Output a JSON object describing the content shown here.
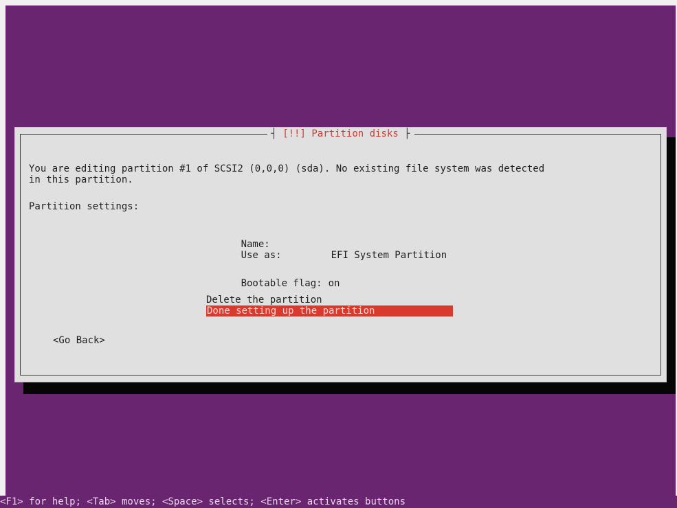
{
  "dialog": {
    "title_prefix": "[!!]",
    "title": "Partition disks",
    "message_line1": "You are editing partition #1 of SCSI2 (0,0,0) (sda). No existing file system was detected",
    "message_line2": "in this partition.",
    "settings_heading": "Partition settings:"
  },
  "settings": {
    "name_label": "Name:",
    "name_value": "",
    "use_as_label": "Use as:",
    "use_as_value": "EFI System Partition",
    "bootable_label": "Bootable flag:",
    "bootable_value": "on"
  },
  "actions": {
    "delete_label": "Delete the partition",
    "done_label": "Done setting up the partition",
    "selected": "done"
  },
  "buttons": {
    "go_back_label": "<Go Back>"
  },
  "status_bar": {
    "text": "<F1> for help; <Tab> moves; <Space> selects; <Enter> activates buttons"
  },
  "colors": {
    "background": "#6a2570",
    "dialog": "#e0e0e0",
    "highlight": "#d83a2e",
    "title": "#d03c32"
  }
}
